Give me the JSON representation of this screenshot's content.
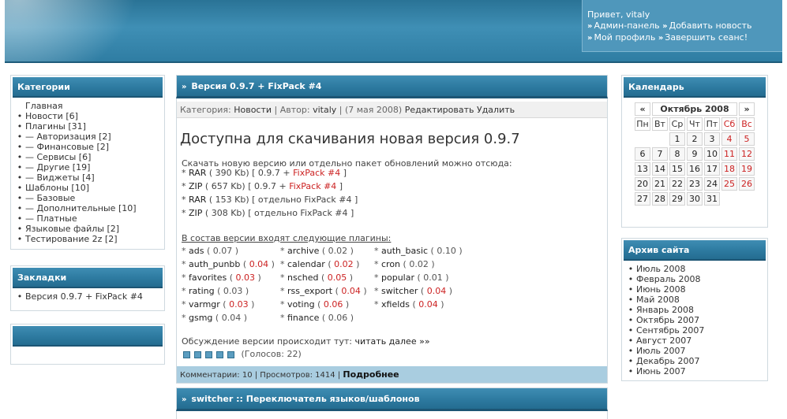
{
  "user": {
    "greeting": "Привет, vitaly",
    "links": [
      "Админ-панель",
      "Добавить новость",
      "Мой профиль",
      "Завершить сеанс!"
    ]
  },
  "categories": {
    "title": "Категории",
    "items": [
      {
        "label": "Главная",
        "bullet": false
      },
      {
        "label": "Новости [6]",
        "bullet": true
      },
      {
        "label": "Плагины [31]",
        "bullet": true
      },
      {
        "label": "— Авторизация [2]",
        "bullet": true
      },
      {
        "label": "— Финансовые [2]",
        "bullet": true
      },
      {
        "label": "— Сервисы [6]",
        "bullet": true
      },
      {
        "label": "— Другие [19]",
        "bullet": true
      },
      {
        "label": "— Виджеты [4]",
        "bullet": true
      },
      {
        "label": "Шаблоны [10]",
        "bullet": true
      },
      {
        "label": "— Базовые",
        "bullet": true
      },
      {
        "label": "— Дополнительные [10]",
        "bullet": true
      },
      {
        "label": "— Платные",
        "bullet": true
      },
      {
        "label": "Языковые файлы [2]",
        "bullet": true
      },
      {
        "label": "Тестирование 2z [2]",
        "bullet": true
      }
    ]
  },
  "bookmarks": {
    "title": "Закладки",
    "items": [
      "Версия 0.9.7 + FixPack #4"
    ]
  },
  "empty_box": {
    "title": ""
  },
  "post": {
    "title": "Версия 0.9.7 + FixPack #4",
    "meta": {
      "category_label": "Категория:",
      "category": "Новости",
      "author_label": "Автор:",
      "author": "vitaly",
      "date": "(7 мая 2008)",
      "edit": "Редактировать",
      "delete": "Удалить"
    },
    "heading": "Доступна для скачивания новая версия 0.9.7",
    "intro": "Скачать новую версию или отдельно пакет обновлений можно отсюда:",
    "downloads": [
      {
        "name": "RAR",
        "size": "( 390 Kb)",
        "desc_pre": "[ 0.9.7 + ",
        "desc_red": "FixPack #4",
        "desc_post": " ]"
      },
      {
        "name": "ZIP",
        "size": "( 657 Kb)",
        "desc_pre": "[ 0.9.7 + ",
        "desc_red": "FixPack #4",
        "desc_post": " ]"
      },
      {
        "name": "RAR",
        "size": "( 153 Kb)",
        "desc_pre": "[ отдельно FixPack #4 ]",
        "desc_red": "",
        "desc_post": ""
      },
      {
        "name": "ZIP",
        "size": "( 308 Kb)",
        "desc_pre": "[ отдельно FixPack #4 ]",
        "desc_red": "",
        "desc_post": ""
      }
    ],
    "plugins_heading": "В состав версии входят следующие плагины:",
    "plugins": [
      [
        {
          "name": "ads",
          "ver": "0.07",
          "red": false
        },
        {
          "name": "archive",
          "ver": "0.02",
          "red": false
        },
        {
          "name": "auth_basic",
          "ver": "0.10",
          "red": false
        }
      ],
      [
        {
          "name": "auth_punbb",
          "ver": "0.04",
          "red": true
        },
        {
          "name": "calendar",
          "ver": "0.02",
          "red": true
        },
        {
          "name": "cron",
          "ver": "0.02",
          "red": false
        }
      ],
      [
        {
          "name": "favorites",
          "ver": "0.03",
          "red": true
        },
        {
          "name": "nsched",
          "ver": "0.05",
          "red": true
        },
        {
          "name": "popular",
          "ver": "0.01",
          "red": false
        }
      ],
      [
        {
          "name": "rating",
          "ver": "0.03",
          "red": false
        },
        {
          "name": "rss_export",
          "ver": "0.04",
          "red": true
        },
        {
          "name": "switcher",
          "ver": "0.04",
          "red": true
        }
      ],
      [
        {
          "name": "varmgr",
          "ver": "0.03",
          "red": true
        },
        {
          "name": "voting",
          "ver": "0.06",
          "red": true
        },
        {
          "name": "xfields",
          "ver": "0.04",
          "red": true
        }
      ],
      [
        {
          "name": "gsmg",
          "ver": "0.04",
          "red": false
        },
        {
          "name": "finance",
          "ver": "0.06",
          "red": false
        },
        null
      ]
    ],
    "discussion": "Обсуждение версии происходит тут:",
    "read_more": "читать далее »»",
    "votes": "(Голосов: 22)",
    "rating_stars": 5,
    "footer_stats": "Комментарии: 10 | Просмотров: 1414 |",
    "footer_more": "Подробнее"
  },
  "post2": {
    "title": "switcher :: Переключатель языков/шаблонов"
  },
  "calendar": {
    "title": "Календарь",
    "prev": "«",
    "month": "Октябрь 2008",
    "next": "»",
    "weekdays": [
      "Пн",
      "Вт",
      "Ср",
      "Чт",
      "Пт",
      "Сб",
      "Вс"
    ],
    "weeks": [
      [
        "",
        "",
        "1",
        "2",
        "3",
        "4",
        "5"
      ],
      [
        "6",
        "7",
        "8",
        "9",
        "10",
        "11",
        "12"
      ],
      [
        "13",
        "14",
        "15",
        "16",
        "17",
        "18",
        "19"
      ],
      [
        "20",
        "21",
        "22",
        "23",
        "24",
        "25",
        "26"
      ],
      [
        "27",
        "28",
        "29",
        "30",
        "31",
        "",
        ""
      ]
    ],
    "weekend_color": "#cc2222"
  },
  "archive": {
    "title": "Архив сайта",
    "items": [
      "Июль 2008",
      "Февраль 2008",
      "Июнь 2008",
      "Май 2008",
      "Январь 2008",
      "Октябрь 2007",
      "Сентябрь 2007",
      "Август 2007",
      "Июль 2007",
      "Декабрь 2007",
      "Июнь 2007"
    ]
  },
  "colors": {
    "header": "#2f7da3",
    "box_head": "#2d7aa0",
    "accent_red": "#cc2222",
    "footer_bar": "#a9cde0"
  }
}
